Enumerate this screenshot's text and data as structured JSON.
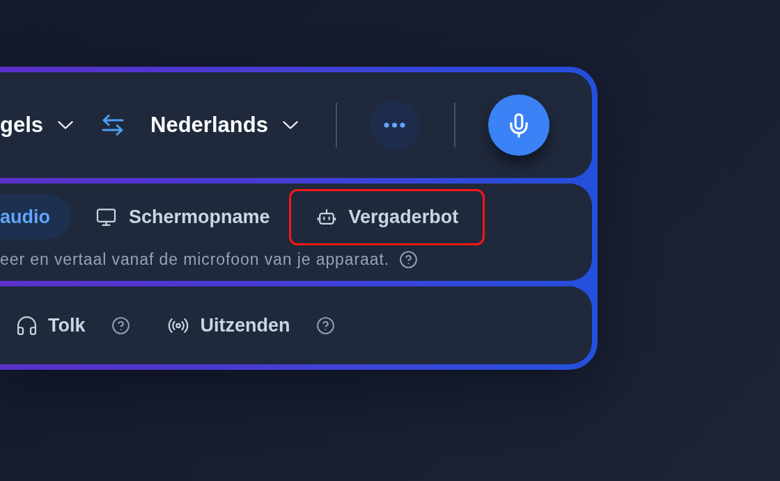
{
  "language_bar": {
    "source_language": "gels",
    "target_language": "Nederlands"
  },
  "input_modes": [
    {
      "label": "audio",
      "kind": "audio",
      "selected": true,
      "highlighted": false
    },
    {
      "label": "Schermopname",
      "kind": "screen",
      "selected": false,
      "highlighted": false
    },
    {
      "label": "Vergaderbot",
      "kind": "bot",
      "selected": false,
      "highlighted": true
    }
  ],
  "mode_description": "eer en vertaal vanaf de microfoon van je apparaat.",
  "output_modes": [
    {
      "label": "Tolk",
      "kind": "interpreter"
    },
    {
      "label": "Uitzenden",
      "kind": "broadcast"
    }
  ]
}
